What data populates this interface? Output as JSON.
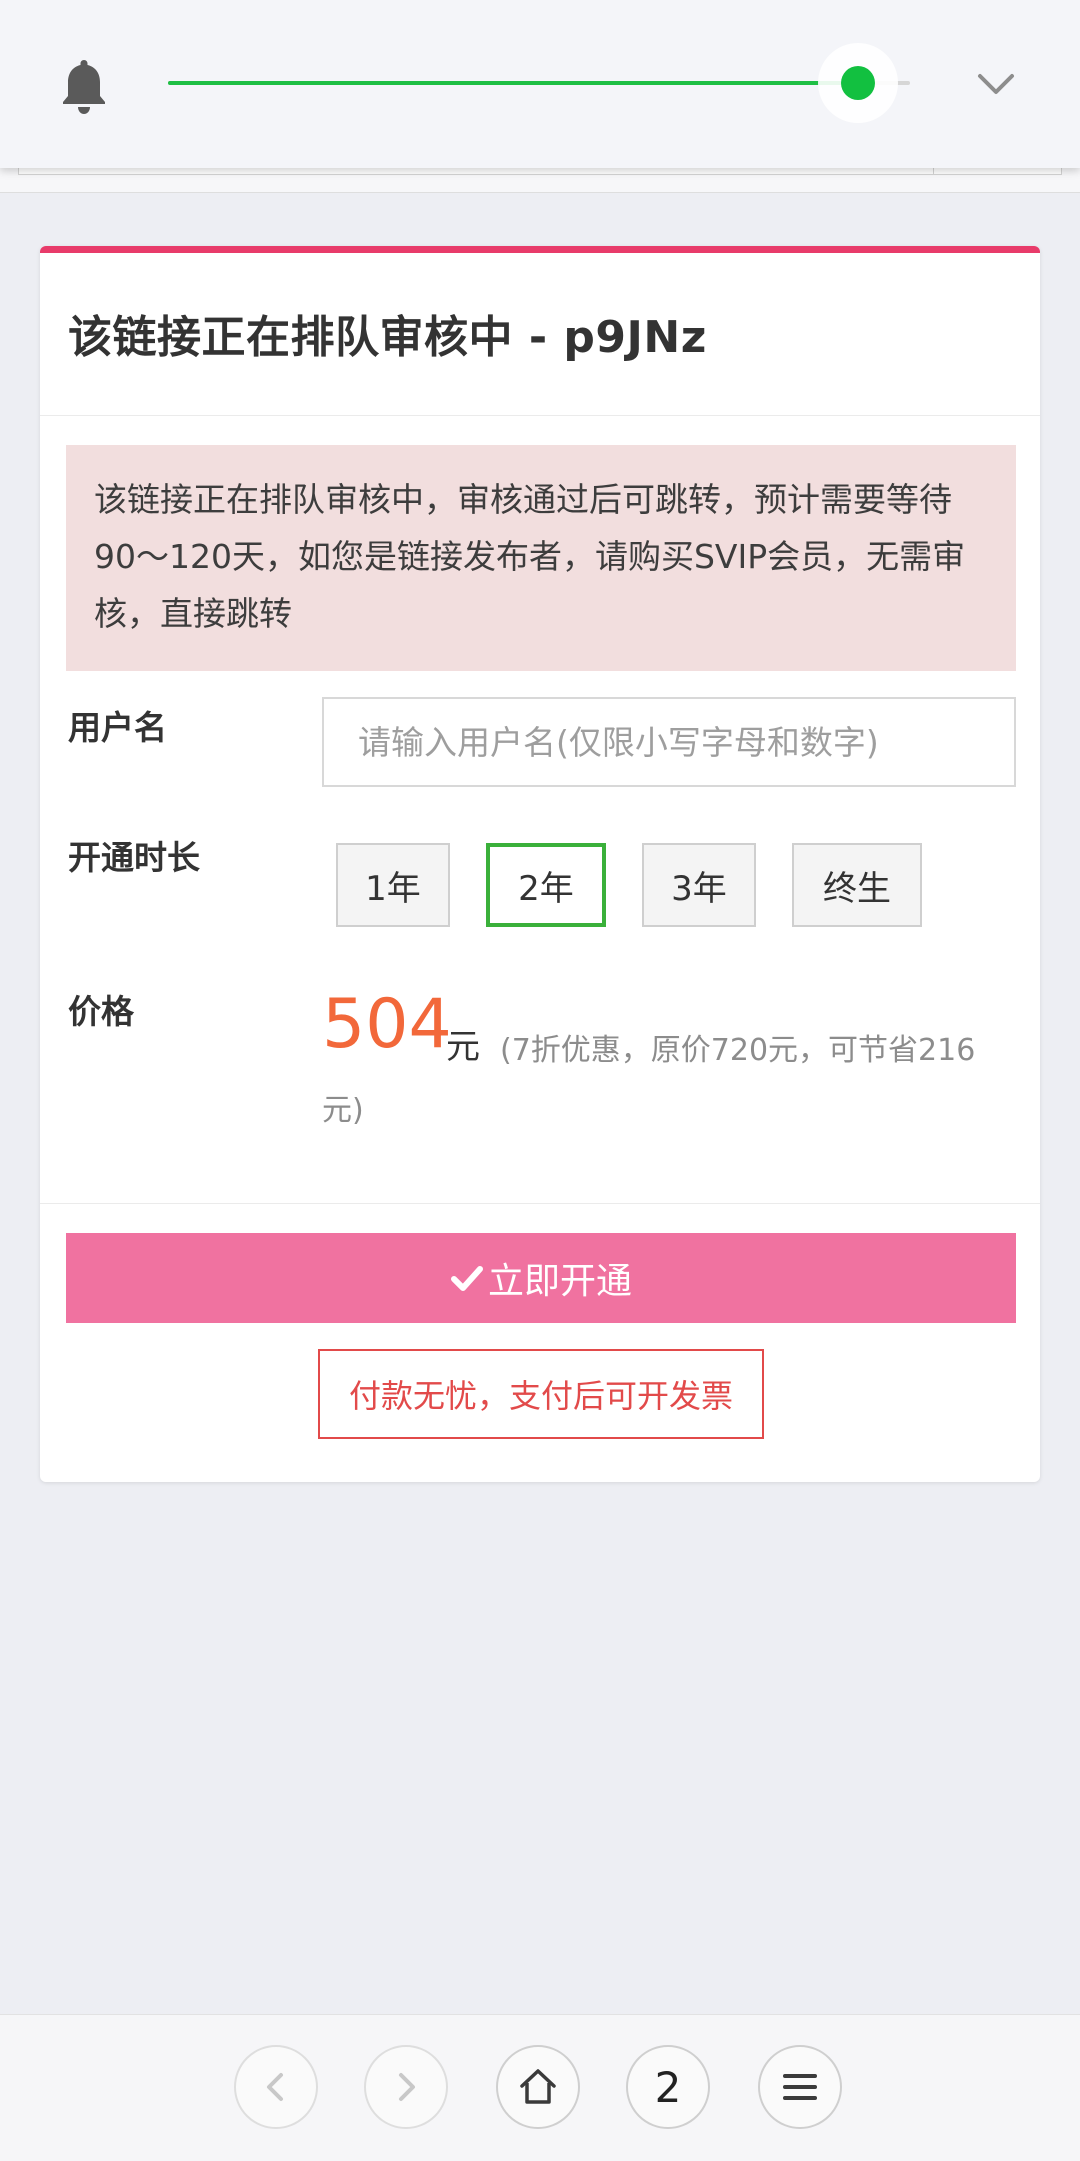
{
  "volume": {
    "level": 0.93
  },
  "card": {
    "title": "该链接正在排队审核中 - p9JNz",
    "alert": "该链接正在排队审核中，审核通过后可跳转，预计需要等待90～120天，如您是链接发布者，请购买SVIP会员，无需审核，直接跳转"
  },
  "form": {
    "username_label": "用户名",
    "username_placeholder": "请输入用户名(仅限小写字母和数字)",
    "username_value": "",
    "duration_label": "开通时长",
    "durations": [
      "1年",
      "2年",
      "3年",
      "终生"
    ],
    "selected_duration": "2年",
    "price_label": "价格",
    "price_value": "504",
    "price_unit": "元",
    "price_note_line1": "(7折优惠，原价720元，可节省216",
    "price_note_line2": "元)"
  },
  "actions": {
    "activate_label": "立即开通",
    "invoice_note": "付款无忧，支付后可开发票"
  },
  "bottom_nav": {
    "tab_count": "2"
  },
  "colors": {
    "accent_pink": "#e83b6a",
    "button_pink": "#f072a0",
    "alert_bg": "#f2dede",
    "price_orange": "#f2683a",
    "selected_green": "#3ab03a",
    "slider_green": "#12c040",
    "invoice_red": "#e24a4a"
  },
  "icons": {
    "bell": "bell-icon",
    "chevron": "chevron-down-icon",
    "check": "check-icon",
    "back": "arrow-left-icon",
    "forward": "arrow-right-icon",
    "home": "home-icon",
    "menu": "menu-icon"
  }
}
